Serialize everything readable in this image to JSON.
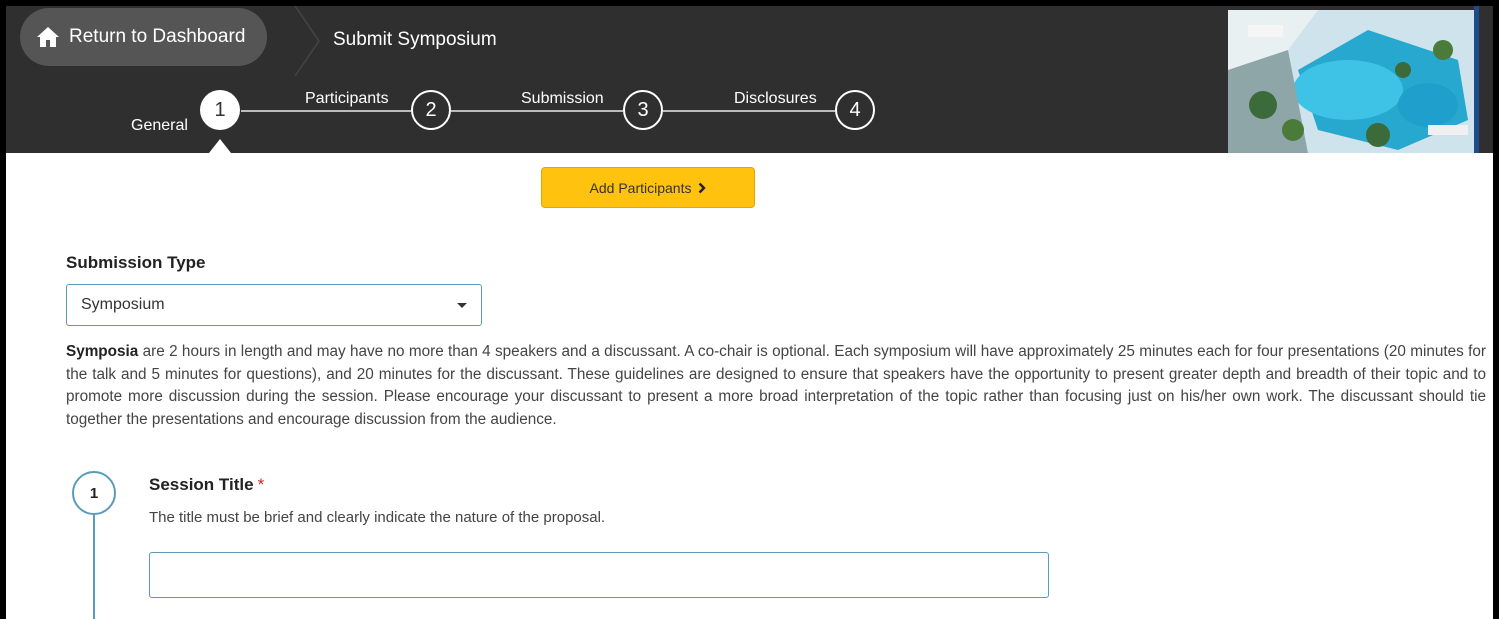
{
  "header": {
    "return_label": "Return to Dashboard",
    "page_title": "Submit Symposium",
    "accent_color": "#2f2f2f"
  },
  "steps": [
    {
      "number": "1",
      "label": "General",
      "active": true
    },
    {
      "number": "2",
      "label": "Participants",
      "active": false
    },
    {
      "number": "3",
      "label": "Submission",
      "active": false
    },
    {
      "number": "4",
      "label": "Disclosures",
      "active": false
    }
  ],
  "main": {
    "add_participants_label": "Add Participants",
    "add_participants_color": "#ffc20e",
    "submission_type": {
      "label": "Submission Type",
      "selected": "Symposium"
    },
    "description": {
      "lead": "Symposia",
      "text": " are 2 hours in length and may have no more than 4 speakers and a discussant. A co-chair is optional. Each symposium will have approximately 25 minutes each for four presentations (20 minutes for the talk and 5 minutes for questions), and 20 minutes for the discussant. These guidelines are designed to ensure that speakers have the opportunity to present greater depth and breadth of their topic and to promote more discussion during the session. Please encourage your discussant to present a more broad interpretation of the topic rather than focusing just on his/her own work. The discussant should tie together the presentations and encourage discussion from the audience."
    },
    "question": {
      "number": "1",
      "title": "Session Title",
      "required_mark": "*",
      "help": "The title must be brief and clearly indicate the nature of the proposal.",
      "value": ""
    }
  },
  "icons": {
    "home": "home-icon",
    "chevron": "chevron-right-icon",
    "caret": "caret-down-icon"
  }
}
